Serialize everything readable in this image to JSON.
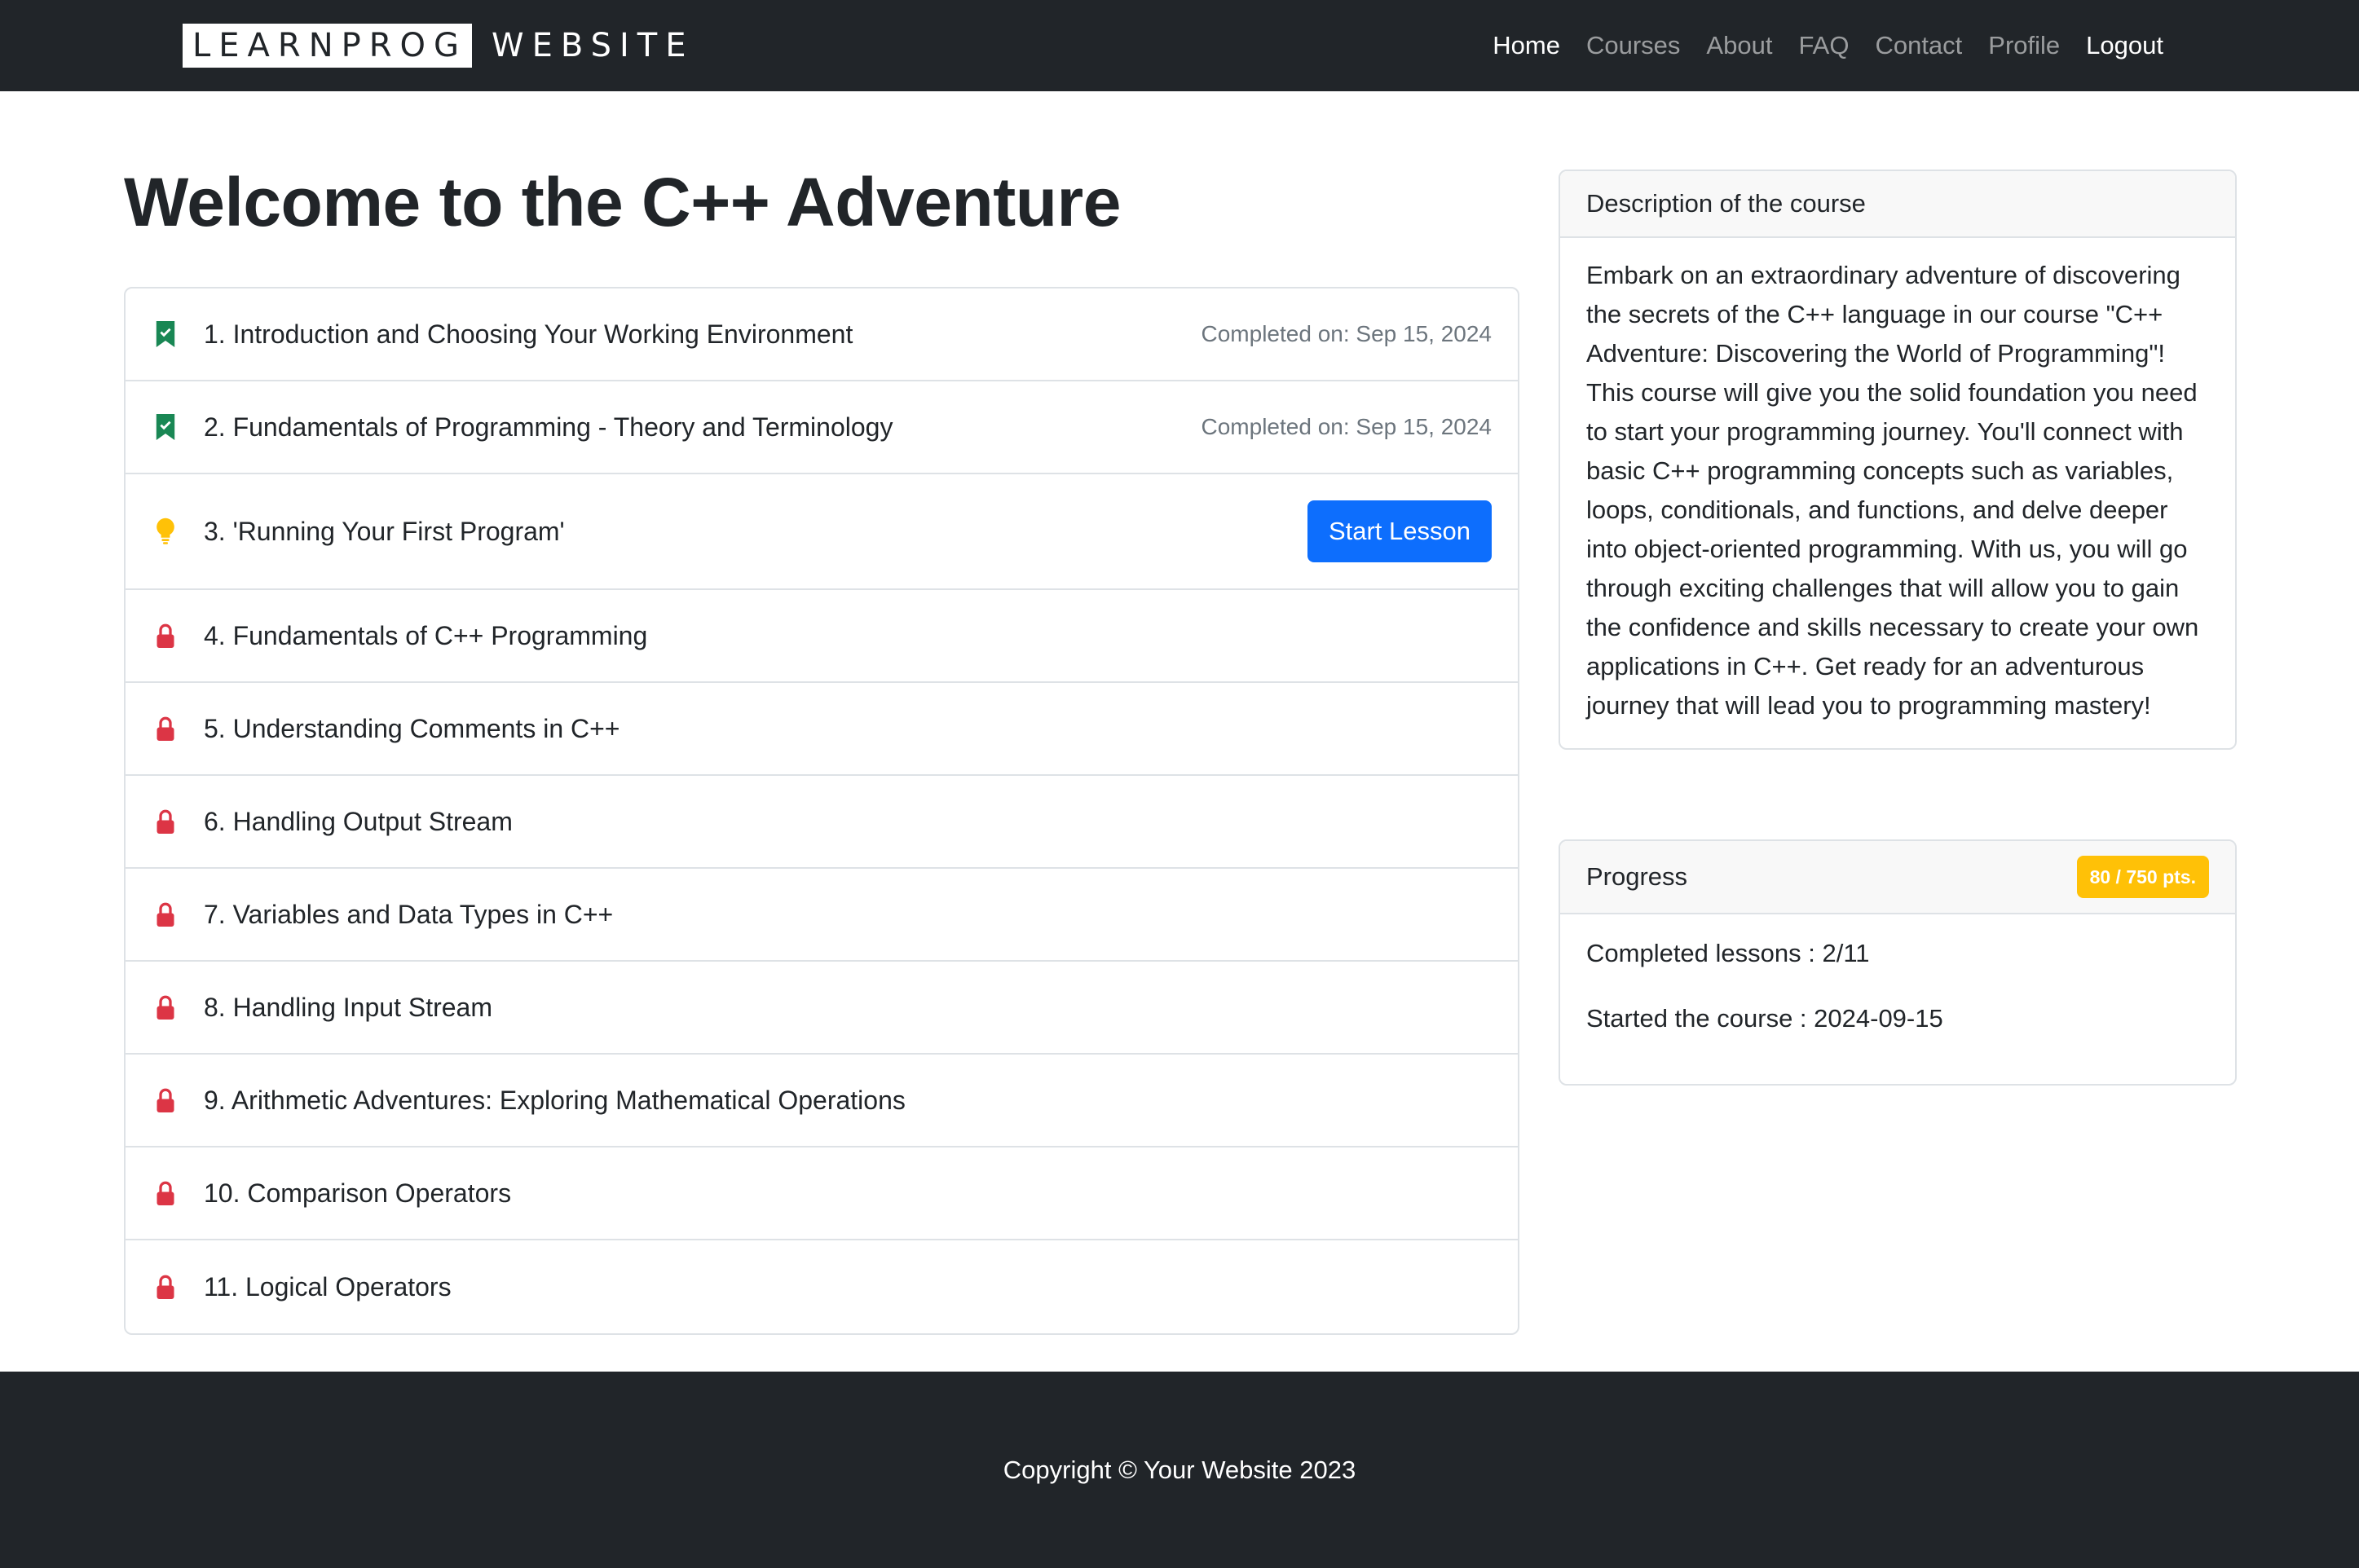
{
  "navbar": {
    "brand_box": "LEARNPROG",
    "brand_rest": "WEBSITE",
    "links": [
      {
        "label": "Home"
      },
      {
        "label": "Courses"
      },
      {
        "label": "About"
      },
      {
        "label": "FAQ"
      },
      {
        "label": "Contact"
      },
      {
        "label": "Profile"
      },
      {
        "label": "Logout"
      }
    ]
  },
  "main": {
    "title": "Welcome to the C++ Adventure",
    "lessons": [
      {
        "title": "1. Introduction and Choosing Your Working Environment",
        "status": "completed",
        "meta": "Completed on: Sep 15, 2024"
      },
      {
        "title": "2. Fundamentals of Programming - Theory and Terminology",
        "status": "completed",
        "meta": "Completed on: Sep 15, 2024"
      },
      {
        "title": "3. 'Running Your First Program'",
        "status": "current",
        "action": "Start Lesson"
      },
      {
        "title": "4. Fundamentals of C++ Programming",
        "status": "locked"
      },
      {
        "title": "5. Understanding Comments in C++",
        "status": "locked"
      },
      {
        "title": "6. Handling Output Stream",
        "status": "locked"
      },
      {
        "title": "7. Variables and Data Types in C++",
        "status": "locked"
      },
      {
        "title": "8. Handling Input Stream",
        "status": "locked"
      },
      {
        "title": "9. Arithmetic Adventures: Exploring Mathematical Operations",
        "status": "locked"
      },
      {
        "title": "10. Comparison Operators",
        "status": "locked"
      },
      {
        "title": "11. Logical Operators",
        "status": "locked"
      }
    ],
    "icons": {
      "completed": "bookmark-check-icon",
      "current": "lightbulb-icon",
      "locked": "lock-icon"
    }
  },
  "description_card": {
    "header": "Description of the course",
    "body": "Embark on an extraordinary adventure of discovering the secrets of the C++ language in our course \"C++ Adventure: Discovering the World of Programming\"! This course will give you the solid foundation you need to start your programming journey. You'll connect with basic C++ programming concepts such as variables, loops, conditionals, and functions, and delve deeper into object-oriented programming. With us, you will go through exciting challenges that will allow you to gain the confidence and skills necessary to create your own applications in C++. Get ready for an adventurous journey that will lead you to programming mastery!"
  },
  "progress_card": {
    "header": "Progress",
    "badge": "80 / 750 pts.",
    "completed_lessons": "Completed lessons : 2/11",
    "started": "Started the course : 2024-09-15"
  },
  "footer": {
    "text": "Copyright © Your Website 2023"
  },
  "colors": {
    "navbar_bg": "#212529",
    "completed_icon": "#198754",
    "current_icon": "#ffc107",
    "locked_icon": "#dc3545",
    "primary": "#0d6efd",
    "badge": "#ffc107"
  }
}
